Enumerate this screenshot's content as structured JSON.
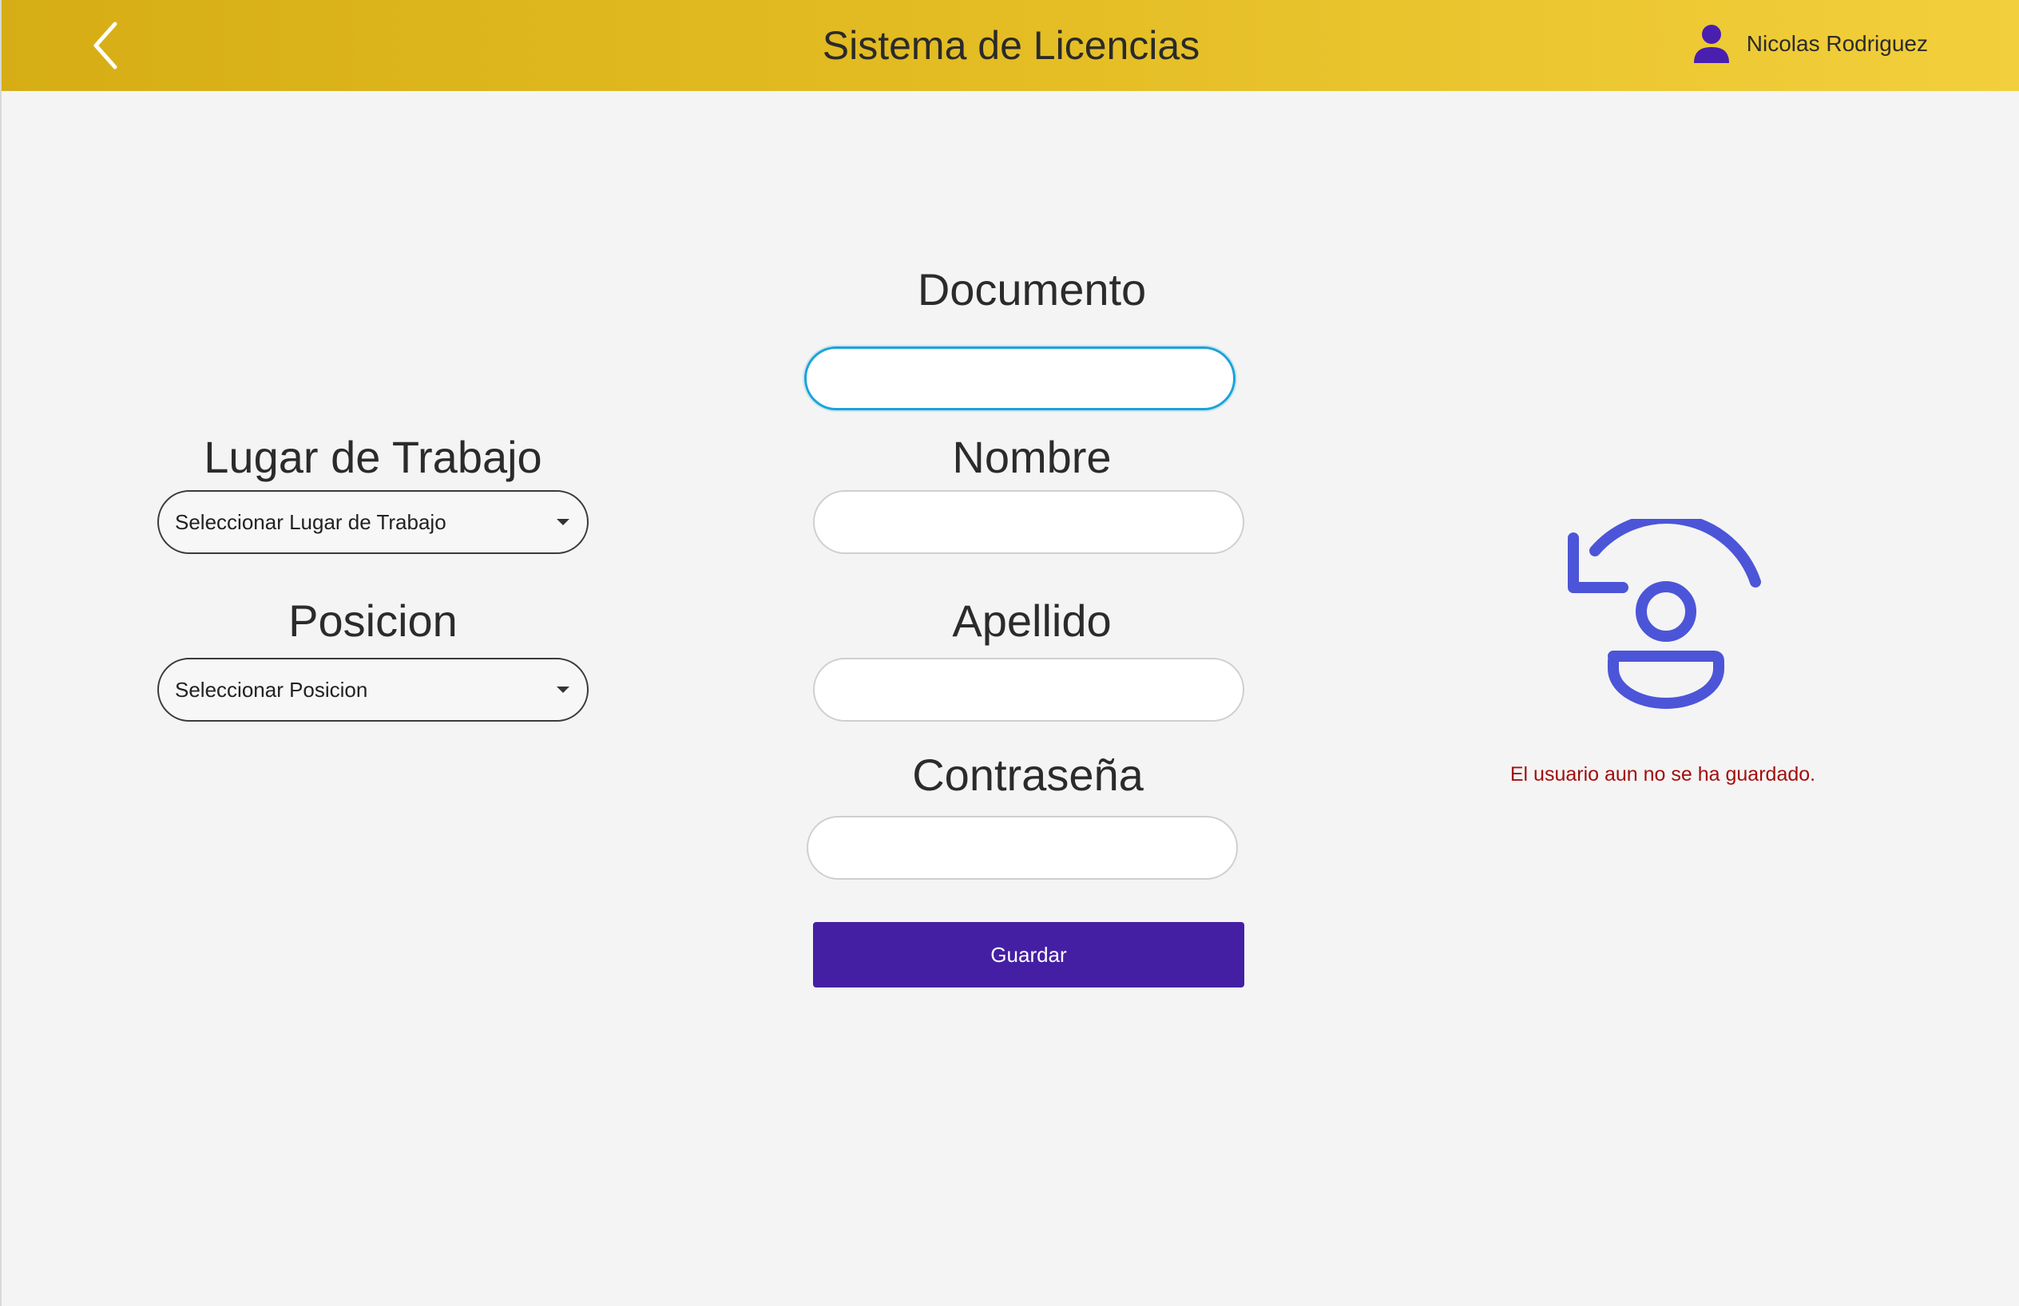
{
  "header": {
    "title": "Sistema de Licencias",
    "user_name": "Nicolas Rodriguez",
    "back_icon": "chevron-left-icon",
    "user_icon": "user-icon",
    "brand_color": "#e4bd24",
    "user_icon_color": "#4a1fb0"
  },
  "form": {
    "documento": {
      "label": "Documento",
      "value": ""
    },
    "nombre": {
      "label": "Nombre",
      "value": ""
    },
    "apellido": {
      "label": "Apellido",
      "value": ""
    },
    "contrasena": {
      "label": "Contraseña",
      "value": ""
    },
    "lugar_trabajo": {
      "label": "Lugar de Trabajo",
      "selected": "Seleccionar Lugar de Trabajo"
    },
    "posicion": {
      "label": "Posicion",
      "selected": "Seleccionar Posicion"
    },
    "save_label": "Guardar",
    "save_color": "#451fa3"
  },
  "status": {
    "icon": "user-not-saved-icon",
    "icon_color": "#4c55d8",
    "message": "El usuario aun no se ha guardado.",
    "message_color": "#a30e0e"
  }
}
